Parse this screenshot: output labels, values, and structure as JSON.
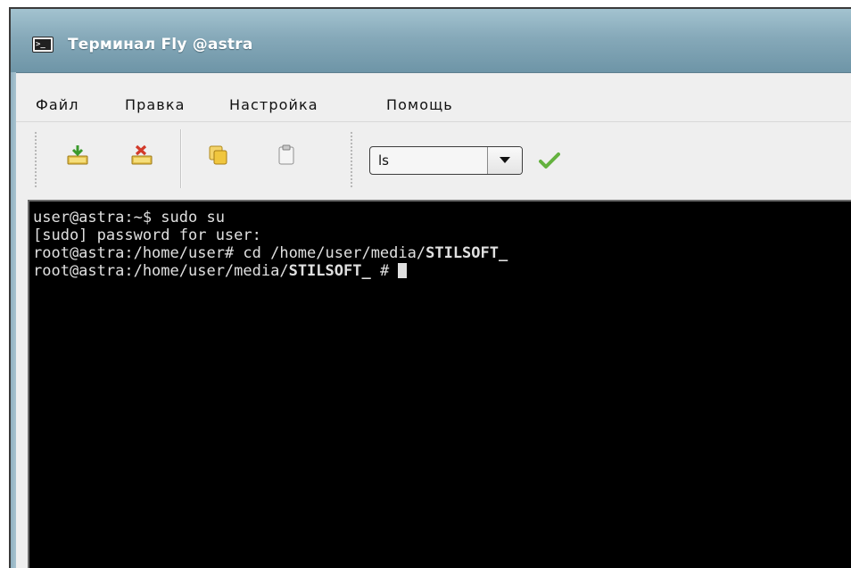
{
  "window": {
    "title": "Терминал Fly @astra",
    "icon": "terminal-icon",
    "title_color": "#ffffff",
    "titlebar_color": "#86a9b9"
  },
  "menubar": {
    "items": [
      {
        "label": "Файл"
      },
      {
        "label": "Правка"
      },
      {
        "label": "Настройка"
      },
      {
        "label": "Помощь"
      }
    ]
  },
  "toolbar": {
    "buttons": [
      {
        "name": "new-tab",
        "icon": "new-tab-icon"
      },
      {
        "name": "close-tab",
        "icon": "close-tab-icon"
      },
      {
        "name": "copy",
        "icon": "copy-icon"
      },
      {
        "name": "paste",
        "icon": "paste-icon"
      }
    ],
    "command_combo": {
      "value": "ls"
    },
    "run_icon": "checkmark-icon"
  },
  "terminal": {
    "background": "#000000",
    "foreground": "#e0e0e0",
    "lines": [
      {
        "prefix": "user@astra:~$ sudo su",
        "bold": ""
      },
      {
        "prefix": "[sudo] password for user:",
        "bold": ""
      },
      {
        "prefix": "root@astra:/home/user# cd /home/user/media/",
        "bold": "STILSOFT_"
      },
      {
        "prefix": "root@astra:/home/user/media/",
        "bold": "STILSOFT_",
        "suffix": " # "
      }
    ]
  }
}
